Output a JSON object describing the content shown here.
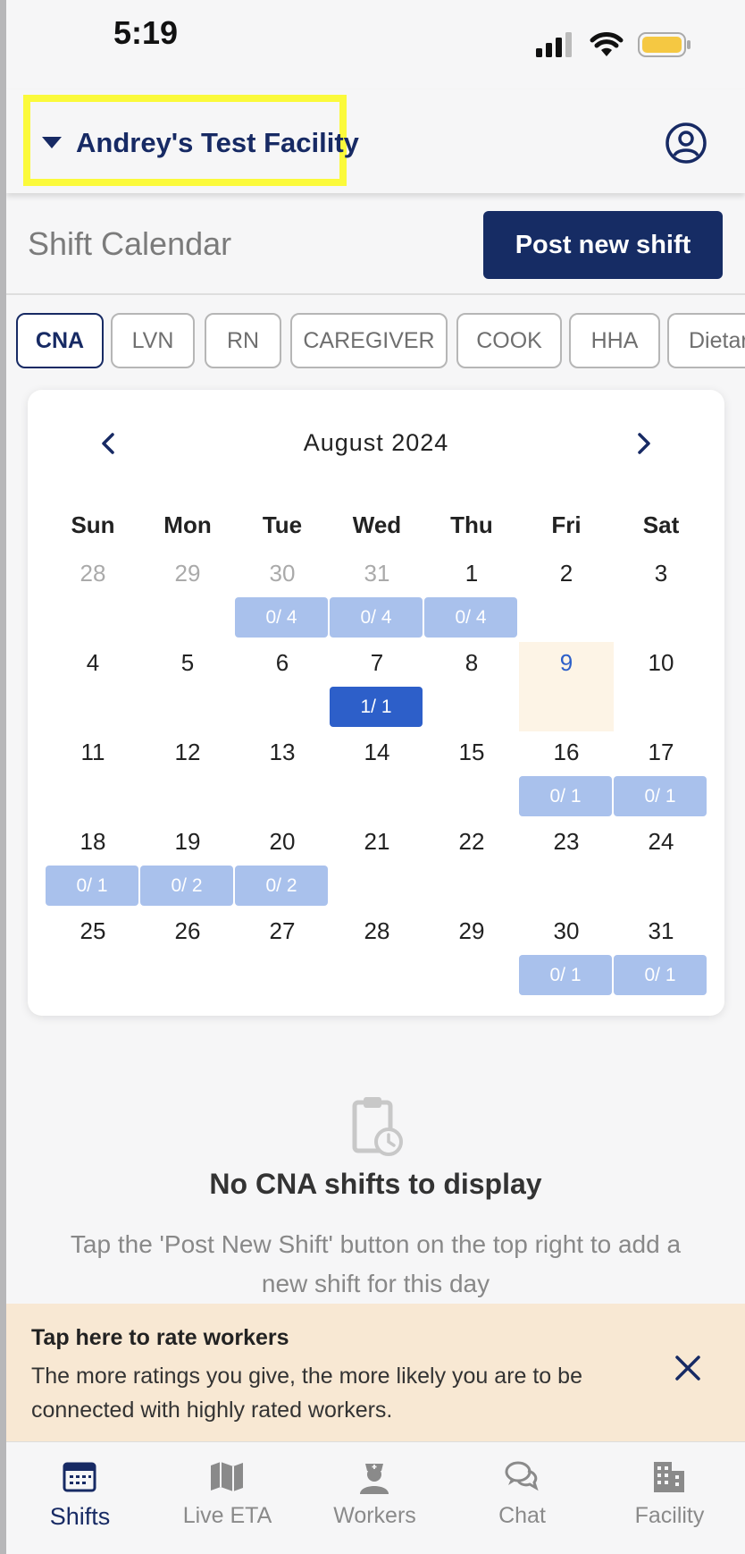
{
  "status_bar": {
    "time": "5:19"
  },
  "header": {
    "facility_name": "Andrey's Test Facility"
  },
  "page": {
    "title": "Shift Calendar",
    "post_button": "Post new shift"
  },
  "roles": [
    "CNA",
    "LVN",
    "RN",
    "CAREGIVER",
    "COOK",
    "HHA",
    "Dietary"
  ],
  "active_role": "CNA",
  "calendar": {
    "month": "August 2024",
    "weekdays": [
      "Sun",
      "Mon",
      "Tue",
      "Wed",
      "Thu",
      "Fri",
      "Sat"
    ],
    "days": [
      {
        "d": "28",
        "muted": true
      },
      {
        "d": "29",
        "muted": true
      },
      {
        "d": "30",
        "muted": true,
        "badge": "0/ 4"
      },
      {
        "d": "31",
        "muted": true,
        "badge": "0/ 4"
      },
      {
        "d": "1",
        "badge": "0/ 4"
      },
      {
        "d": "2"
      },
      {
        "d": "3"
      },
      {
        "d": "4"
      },
      {
        "d": "5"
      },
      {
        "d": "6"
      },
      {
        "d": "7",
        "badge": "1/ 1",
        "filled": true
      },
      {
        "d": "8"
      },
      {
        "d": "9",
        "today": true
      },
      {
        "d": "10"
      },
      {
        "d": "11"
      },
      {
        "d": "12"
      },
      {
        "d": "13"
      },
      {
        "d": "14"
      },
      {
        "d": "15"
      },
      {
        "d": "16",
        "badge": "0/ 1"
      },
      {
        "d": "17",
        "badge": "0/ 1"
      },
      {
        "d": "18",
        "badge": "0/ 1"
      },
      {
        "d": "19",
        "badge": "0/ 2"
      },
      {
        "d": "20",
        "badge": "0/ 2"
      },
      {
        "d": "21"
      },
      {
        "d": "22"
      },
      {
        "d": "23"
      },
      {
        "d": "24"
      },
      {
        "d": "25"
      },
      {
        "d": "26"
      },
      {
        "d": "27"
      },
      {
        "d": "28"
      },
      {
        "d": "29"
      },
      {
        "d": "30",
        "badge": "0/ 1"
      },
      {
        "d": "31",
        "badge": "0/ 1"
      }
    ]
  },
  "empty_state": {
    "title": "No CNA shifts to display",
    "text": "Tap the 'Post New Shift' button on the top right to add a new shift for this day"
  },
  "banner": {
    "title": "Tap here to rate workers",
    "text": "The more ratings you give, the more likely you are to be connected with highly rated workers."
  },
  "nav": [
    "Shifts",
    "Live ETA",
    "Workers",
    "Chat",
    "Facility"
  ],
  "colors": {
    "brand": "#162c64",
    "accent": "#2d5fc9",
    "badge": "#a9c1ec",
    "highlight": "#fbfa3b"
  }
}
